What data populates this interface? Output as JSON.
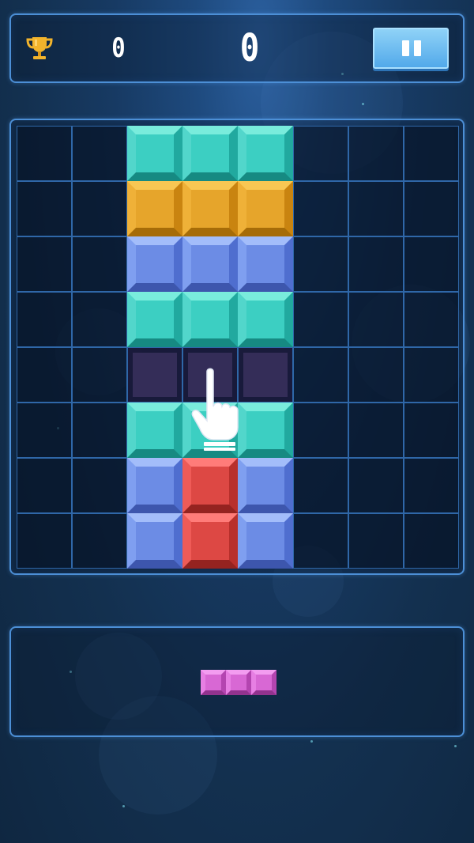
{
  "header": {
    "best_score": "0",
    "current_score": "0",
    "trophy_icon": "trophy-icon",
    "pause_icon": "pause-icon"
  },
  "board": {
    "rows": 8,
    "cols": 8,
    "cells": [
      [
        "",
        "",
        "teal",
        "teal",
        "teal",
        "",
        "",
        ""
      ],
      [
        "",
        "",
        "orange",
        "orange",
        "orange",
        "",
        "",
        ""
      ],
      [
        "",
        "",
        "blue",
        "blue",
        "blue",
        "",
        "",
        ""
      ],
      [
        "",
        "",
        "teal",
        "teal",
        "teal",
        "",
        "",
        ""
      ],
      [
        "",
        "",
        "ghost",
        "ghost",
        "ghost",
        "",
        "",
        ""
      ],
      [
        "",
        "",
        "teal",
        "teal",
        "teal",
        "",
        "",
        ""
      ],
      [
        "",
        "",
        "blue",
        "red",
        "blue",
        "",
        "",
        ""
      ],
      [
        "",
        "",
        "blue",
        "red",
        "blue",
        "",
        "",
        ""
      ]
    ]
  },
  "tutorial": {
    "hint_icon": "pointing-hand-icon"
  },
  "tray": {
    "pieces": [
      {
        "color": "pink",
        "shape": [
          [
            1,
            1,
            1
          ]
        ]
      }
    ]
  },
  "colors": {
    "teal": {
      "top": "#79ecdc",
      "left": "#52d6cb",
      "right": "#21a99f",
      "bottom": "#168a82",
      "face": "#3ccfc2"
    },
    "orange": {
      "top": "#f8c753",
      "left": "#efb138",
      "right": "#c98410",
      "bottom": "#a66c08",
      "face": "#e6a52b"
    },
    "blue": {
      "top": "#a3bdfa",
      "left": "#7f9ff0",
      "right": "#4f6ecf",
      "bottom": "#3d56ad",
      "face": "#6c8ce5"
    },
    "red": {
      "top": "#ff7c79",
      "left": "#ef5b57",
      "right": "#b8302c",
      "bottom": "#952320",
      "face": "#dd4844"
    },
    "pink": {
      "top": "#f39cf0",
      "left": "#e77fe3",
      "right": "#b445b0",
      "bottom": "#92338e",
      "face": "#d868d4"
    }
  }
}
